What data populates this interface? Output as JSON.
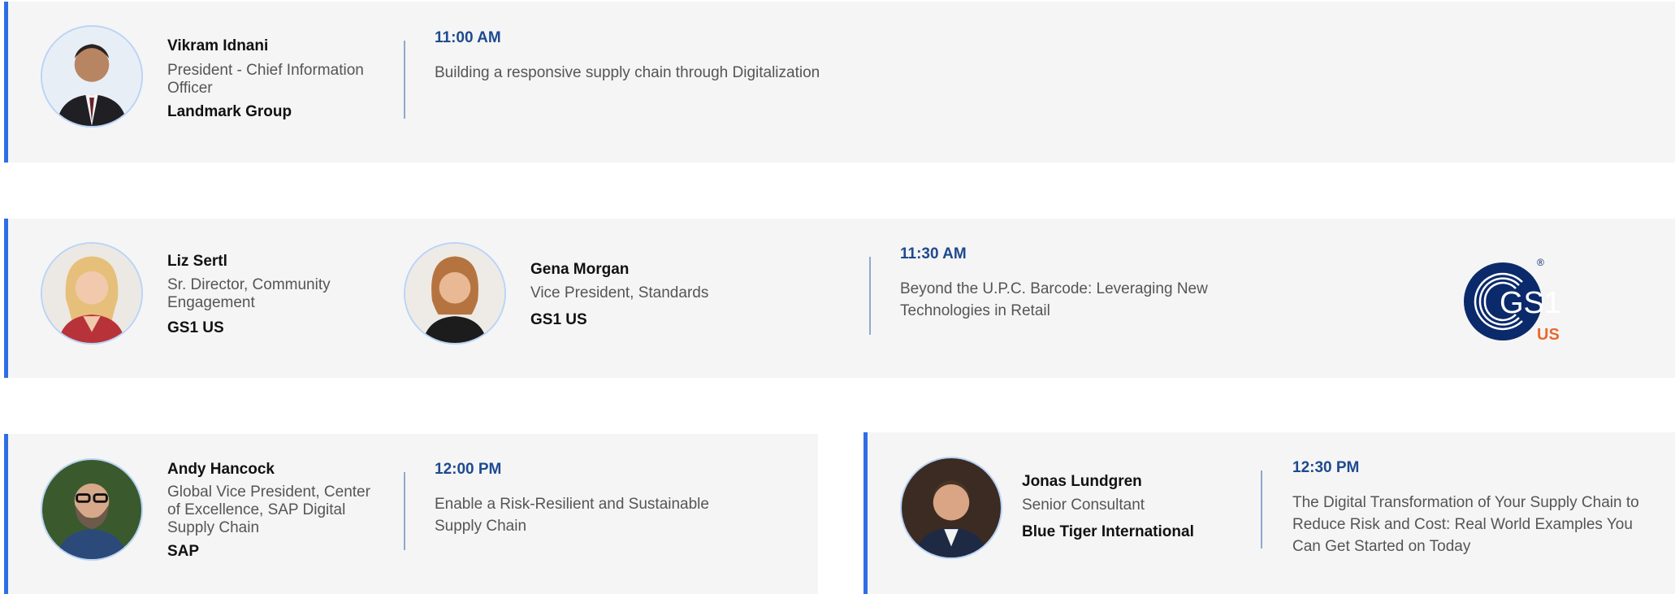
{
  "sessions": [
    {
      "time": "11:00 AM",
      "title": "Building a responsive supply chain through Digitalization",
      "speakers": [
        {
          "name": "Vikram Idnani",
          "role": "President - Chief Information Officer",
          "company": "Landmark Group"
        }
      ]
    },
    {
      "time": "11:30 AM",
      "title": "Beyond the U.P.C. Barcode: Leveraging New Technologies in Retail",
      "speakers": [
        {
          "name": "Liz Sertl",
          "role": "Sr. Director, Community Engagement",
          "company": "GS1 US"
        },
        {
          "name": "Gena Morgan",
          "role": "Vice President, Standards",
          "company": "GS1 US"
        }
      ],
      "logo": {
        "main": "GS1",
        "sub": "US",
        "mark": "®",
        "color": "#0b2a6b",
        "accent": "#e86a2e"
      }
    },
    {
      "time": "12:00 PM",
      "title": "Enable a Risk-Resilient and Sustainable Supply Chain",
      "speakers": [
        {
          "name": "Andy Hancock",
          "role": "Global Vice President, Center of Excellence, SAP Digital Supply Chain",
          "company": "SAP"
        }
      ]
    },
    {
      "time": "12:30 PM",
      "title": "The Digital Transformation of Your Supply Chain to Reduce Risk and Cost: Real World Examples You Can Get Started on Today",
      "speakers": [
        {
          "name": "Jonas Lundgren",
          "role": "Senior Consultant",
          "company": "Blue Tiger International"
        }
      ]
    }
  ],
  "colors": {
    "accent_border": "#2f6ee6",
    "time_text": "#1e4a8f",
    "card_bg": "#f5f5f5"
  }
}
